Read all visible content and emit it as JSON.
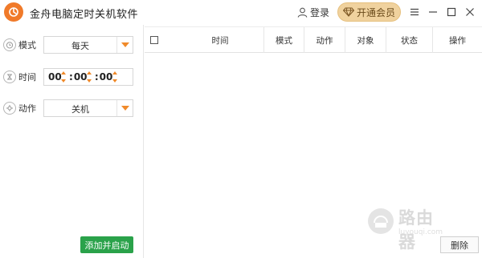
{
  "app": {
    "title": "金舟电脑定时关机软件",
    "login_label": "登录",
    "vip_label": "开通会员",
    "accent_color": "#f08a2a",
    "logo_icon": "power-logo"
  },
  "form": {
    "mode": {
      "label": "模式",
      "value": "每天",
      "icon": "alarm-clock-icon"
    },
    "time": {
      "label": "时间",
      "hour": "00",
      "minute": "00",
      "second": "00",
      "icon": "timer-icon"
    },
    "action": {
      "label": "动作",
      "value": "关机",
      "icon": "wrench-icon"
    },
    "submit_label": "添加并启动"
  },
  "table": {
    "columns": [
      "时间",
      "模式",
      "动作",
      "对象",
      "状态",
      "操作"
    ],
    "rows": [],
    "delete_label": "删除"
  },
  "watermark": {
    "text": "路由器",
    "sub": "luyouqi.com"
  }
}
